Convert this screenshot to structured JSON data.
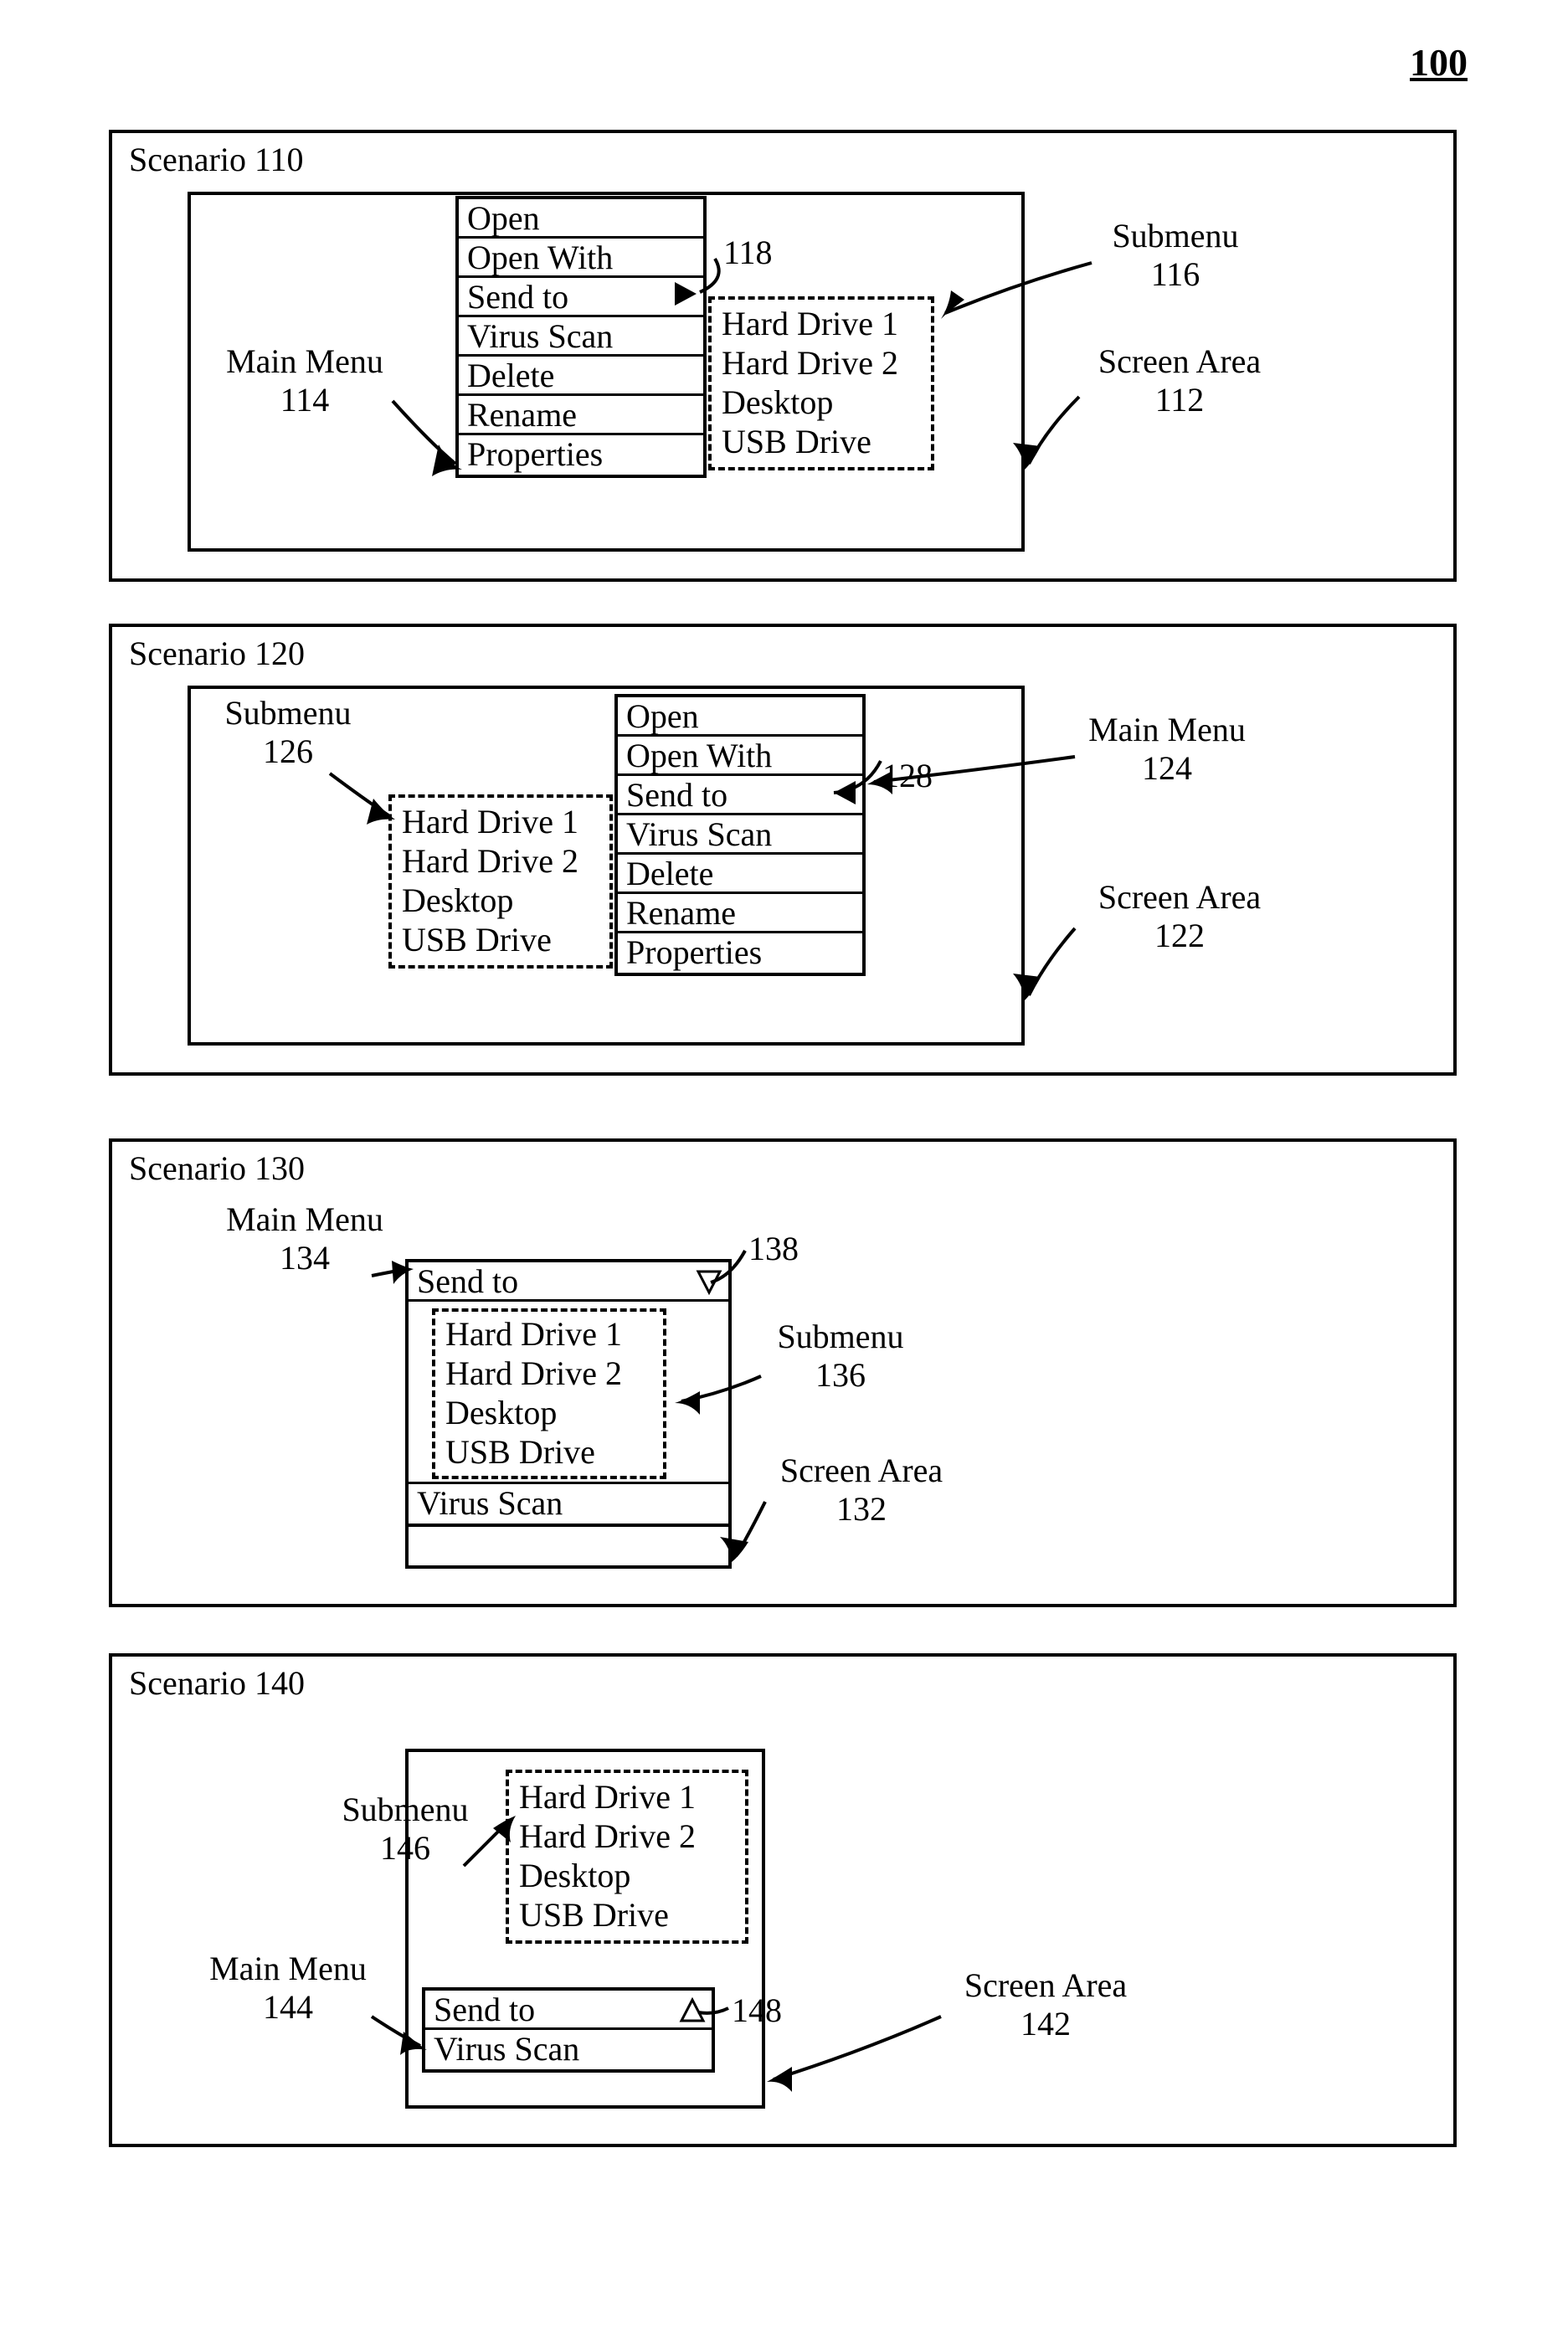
{
  "figure_number": "100",
  "main_menu_items": {
    "open": "Open",
    "open_with": "Open With",
    "send_to": "Send to",
    "virus_scan": "Virus Scan",
    "delete": "Delete",
    "rename": "Rename",
    "properties": "Properties"
  },
  "submenu_items": {
    "hd1": "Hard Drive 1",
    "hd2": "Hard Drive 2",
    "desktop": "Desktop",
    "usb": "USB Drive"
  },
  "scenarios": {
    "s110": {
      "title": "Scenario 110",
      "labels": {
        "main_menu": "Main Menu\n114",
        "submenu": "Submenu\n116",
        "screen_area": "Screen Area\n112",
        "indicator": "118"
      }
    },
    "s120": {
      "title": "Scenario 120",
      "labels": {
        "main_menu": "Main Menu\n124",
        "submenu": "Submenu\n126",
        "screen_area": "Screen Area\n122",
        "indicator": "128"
      }
    },
    "s130": {
      "title": "Scenario 130",
      "labels": {
        "main_menu": "Main Menu\n134",
        "submenu": "Submenu\n136",
        "screen_area": "Screen Area\n132",
        "indicator": "138"
      }
    },
    "s140": {
      "title": "Scenario 140",
      "labels": {
        "main_menu": "Main Menu\n144",
        "submenu": "Submenu\n146",
        "screen_area": "Screen Area\n142",
        "indicator": "148"
      }
    }
  }
}
